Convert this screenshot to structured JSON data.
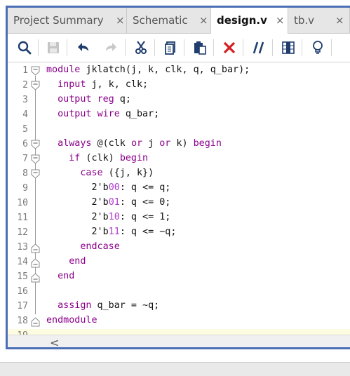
{
  "tabs": [
    {
      "label": "Project Summary",
      "close": "×",
      "active": false
    },
    {
      "label": "Schematic",
      "close": "×",
      "active": false
    },
    {
      "label": "design.v",
      "close": "×",
      "active": true
    },
    {
      "label": "tb.v",
      "close": "×",
      "active": false
    }
  ],
  "toolbar": {
    "icons": [
      "search-icon",
      "save-icon",
      "undo-icon",
      "redo-icon",
      "cut-icon",
      "copy-icon",
      "paste-icon",
      "delete-icon",
      "comment-icon",
      "column-select-icon",
      "lightbulb-icon"
    ]
  },
  "editor": {
    "lines": [
      {
        "n": "1",
        "text": "module jklatch(j, k, clk, q, q_bar);"
      },
      {
        "n": "2",
        "text": "  input j, k, clk;"
      },
      {
        "n": "3",
        "text": "  output reg q;"
      },
      {
        "n": "4",
        "text": "  output wire q_bar;"
      },
      {
        "n": "5",
        "text": ""
      },
      {
        "n": "6",
        "text": "  always @(clk or j or k) begin"
      },
      {
        "n": "7",
        "text": "    if (clk) begin"
      },
      {
        "n": "8",
        "text": "      case ({j, k})"
      },
      {
        "n": "9",
        "text": "        2'b00: q <= q;"
      },
      {
        "n": "10",
        "text": "        2'b01: q <= 0;"
      },
      {
        "n": "11",
        "text": "        2'b10: q <= 1;"
      },
      {
        "n": "12",
        "text": "        2'b11: q <= ~q;"
      },
      {
        "n": "13",
        "text": "      endcase"
      },
      {
        "n": "14",
        "text": "    end"
      },
      {
        "n": "15",
        "text": "  end"
      },
      {
        "n": "16",
        "text": ""
      },
      {
        "n": "17",
        "text": "  assign q_bar = ~q;"
      },
      {
        "n": "18",
        "text": "endmodule"
      },
      {
        "n": "19",
        "text": ""
      }
    ]
  },
  "scrollbar": {
    "left_arrow": "<"
  },
  "colors": {
    "keyword": "#8b008b",
    "number": "#b23bd1",
    "frame": "#4a6fb5",
    "current_line": "#fdfce0"
  }
}
